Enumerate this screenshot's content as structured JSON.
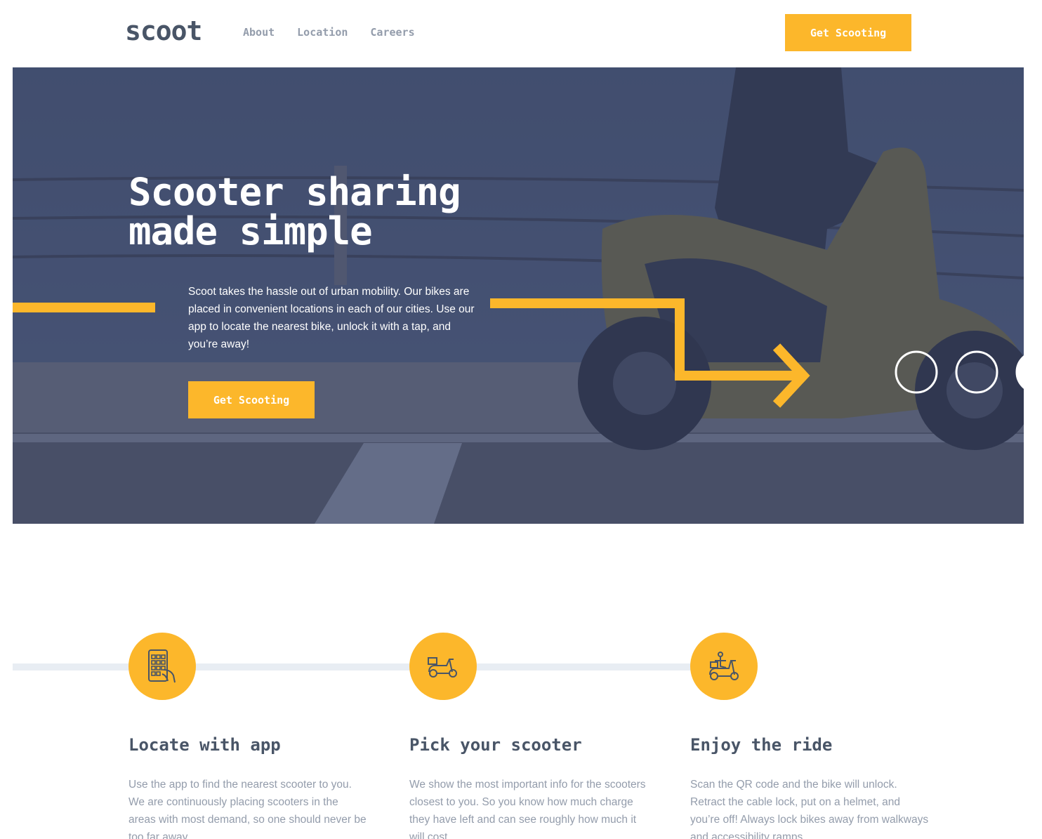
{
  "brand": {
    "logo": "scoot",
    "accent": "#fcb72b",
    "dark": "#495567",
    "muted": "#939cab"
  },
  "nav": {
    "items": [
      "About",
      "Location",
      "Careers"
    ]
  },
  "header": {
    "cta": "Get Scooting"
  },
  "hero": {
    "title_line1": "Scooter sharing",
    "title_line2": "made simple",
    "text": "Scoot takes the hassle out of urban mobility. Our bikes are placed in convenient locations in each of our cities. Use our app to locate the nearest bike, unlock it with a tap, and you’re away!",
    "cta": "Get Scooting"
  },
  "features": [
    {
      "icon": "phone-app-icon",
      "title": "Locate with app",
      "text": "Use the app to find the nearest scooter to you. We are continuously placing scooters in the areas with most demand, so one should never be too far away."
    },
    {
      "icon": "scooter-icon",
      "title": "Pick your scooter",
      "text": "We show the most important info for the scooters closest to you. So you know how much charge they have left and can see roughly how much it will cost."
    },
    {
      "icon": "ride-icon",
      "title": "Enjoy the ride",
      "text": "Scan the QR code and the bike will unlock. Retract the cable lock, put on a helmet, and you’re off! Always lock bikes away from walkways and accessibility ramps."
    }
  ]
}
